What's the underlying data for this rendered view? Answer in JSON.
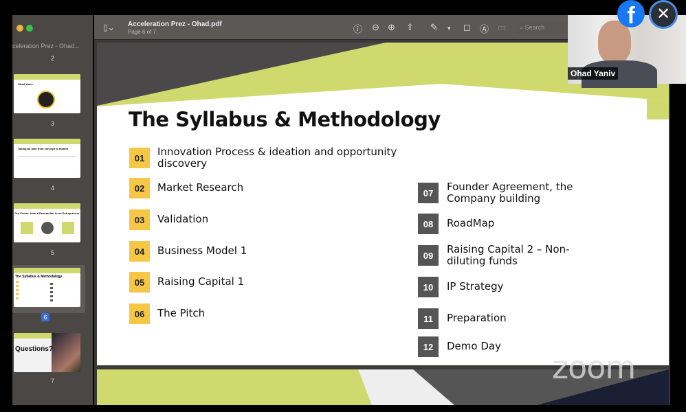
{
  "viewer": {
    "file_title": "Acceleration Prez - Ohad.pdf",
    "page_info": "Page 6 of 7",
    "sidebar_title": "celeration Prez - Ohad...",
    "search_placeholder": "Search"
  },
  "thumbnails": [
    {
      "page": "2"
    },
    {
      "page": "3",
      "text": "Ohad Yaniv"
    },
    {
      "page": "4",
      "text": "Taking an idea from concept to market"
    },
    {
      "page": "5",
      "text": "Our Focus: from a Researcher to an Entrepreneur"
    },
    {
      "page": "6",
      "text": "The Syllabus & Methodology",
      "selected": true
    },
    {
      "page": "7",
      "text": "Questions?"
    }
  ],
  "slide": {
    "title": "The Syllabus & Methodology",
    "items": [
      {
        "num": "01",
        "text": "Innovation Process & ideation and opportunity discovery"
      },
      {
        "num": "02",
        "text": "Market Research"
      },
      {
        "num": "03",
        "text": "Validation"
      },
      {
        "num": "04",
        "text": "Business Model 1"
      },
      {
        "num": "05",
        "text": "Raising Capital 1"
      },
      {
        "num": "06",
        "text": "The Pitch"
      },
      {
        "num": "07",
        "text": "Founder Agreement, the Company building"
      },
      {
        "num": "08",
        "text": "RoadMap"
      },
      {
        "num": "09",
        "text": "Raising Capital 2 – Non-diluting funds"
      },
      {
        "num": "10",
        "text": "IP Strategy"
      },
      {
        "num": "11",
        "text": "Preparation"
      },
      {
        "num": "12",
        "text": "Demo Day"
      }
    ]
  },
  "video": {
    "participant": "Ohad Yaniv",
    "watermark": "zoom"
  },
  "colors": {
    "accent_green": "#cfd96e",
    "number_yellow": "#f6c744",
    "number_gray": "#555555",
    "facebook": "#1877f2"
  }
}
